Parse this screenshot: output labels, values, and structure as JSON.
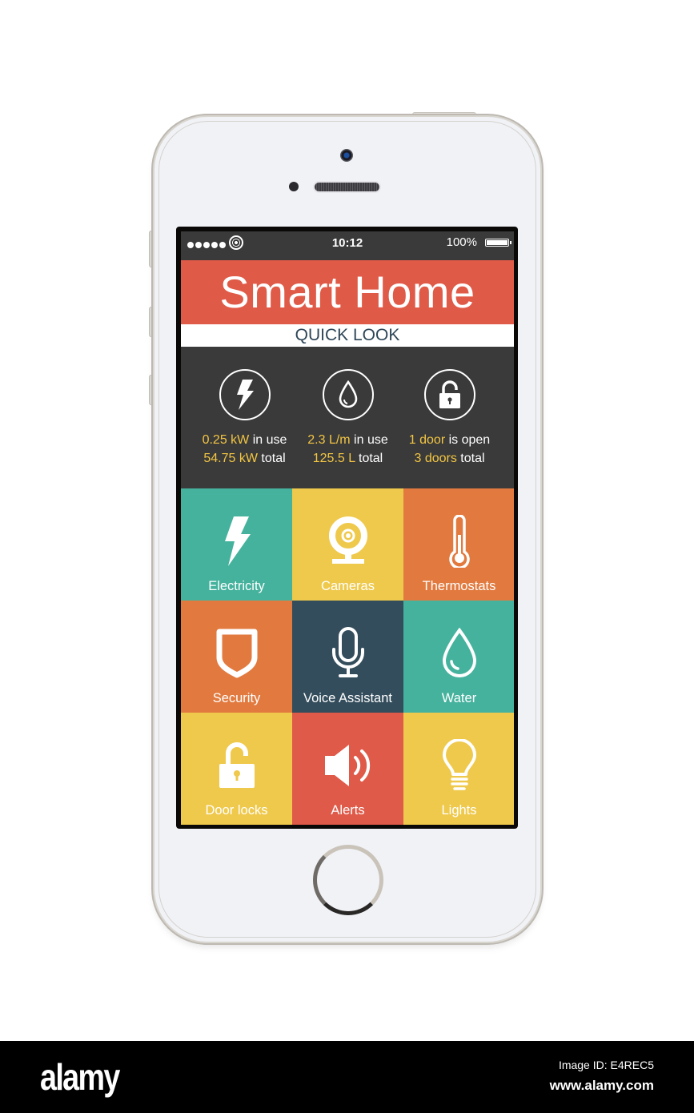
{
  "statusbar": {
    "signal_dots": 5,
    "time": "10:12",
    "battery_percent_label": "100%",
    "battery_level": 1.0
  },
  "header": {
    "title": "Smart Home",
    "subtitle": "QUICK LOOK"
  },
  "quick_look": [
    {
      "icon": "lightning-icon",
      "line1_value": "0.25 kW",
      "line1_text": " in use",
      "line2_value": "54.75 kW",
      "line2_text": " total"
    },
    {
      "icon": "water-drop-icon",
      "line1_value": "2.3 L/m",
      "line1_text": " in use",
      "line2_value": "125.5 L",
      "line2_text": " total"
    },
    {
      "icon": "unlocked-padlock-icon",
      "line1_value": "1 door",
      "line1_text": " is open",
      "line2_value": "3 doors",
      "line2_text": " total"
    }
  ],
  "tiles": [
    {
      "label": "Electricity",
      "icon": "lightning-icon",
      "color": "#45b29d"
    },
    {
      "label": "Cameras",
      "icon": "webcam-icon",
      "color": "#efc94c"
    },
    {
      "label": "Thermostats",
      "icon": "thermometer-icon",
      "color": "#e27a3f"
    },
    {
      "label": "Security",
      "icon": "shield-icon",
      "color": "#e27a3f"
    },
    {
      "label": "Voice Assistant",
      "icon": "microphone-icon",
      "color": "#334d5c"
    },
    {
      "label": "Water",
      "icon": "water-drop-icon",
      "color": "#45b29d"
    },
    {
      "label": "Door locks",
      "icon": "unlocked-padlock-icon",
      "color": "#efc94c"
    },
    {
      "label": "Alerts",
      "icon": "speaker-icon",
      "color": "#df5a49"
    },
    {
      "label": "Lights",
      "icon": "lightbulb-icon",
      "color": "#efc94c"
    }
  ],
  "colors": {
    "header_red": "#e05a48",
    "subheader_text": "#2e4657",
    "quicklook_bg": "#3a3a3a",
    "highlight_yellow": "#f2c543"
  },
  "footer": {
    "logo": "alamy",
    "image_id": "Image ID: E4REC5",
    "site": "www.alamy.com"
  }
}
